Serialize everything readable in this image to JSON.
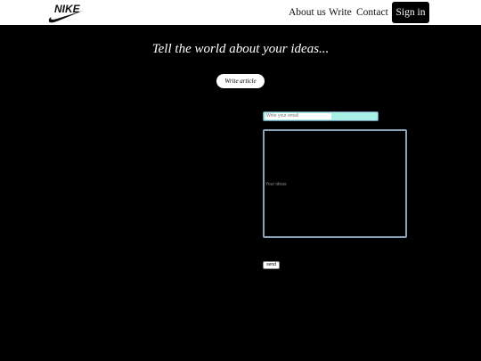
{
  "nav": {
    "brand": "NIKE",
    "brand_icon": "swoosh-icon",
    "links": [
      {
        "label": "About us"
      },
      {
        "label": "Write"
      },
      {
        "label": "Contact"
      }
    ],
    "signin_label": "Sign in"
  },
  "hero": {
    "tagline": "Tell the world about your ideas...",
    "write_button": "Write article"
  },
  "form": {
    "email_placeholder": "Write your email",
    "ideas_placeholder": "Your ideas",
    "send_label": "send"
  },
  "colors": {
    "background": "#000000",
    "navbar": "#ffffff",
    "email_accent": "#a8f0e6",
    "textarea_border": "#8aa4bc"
  }
}
